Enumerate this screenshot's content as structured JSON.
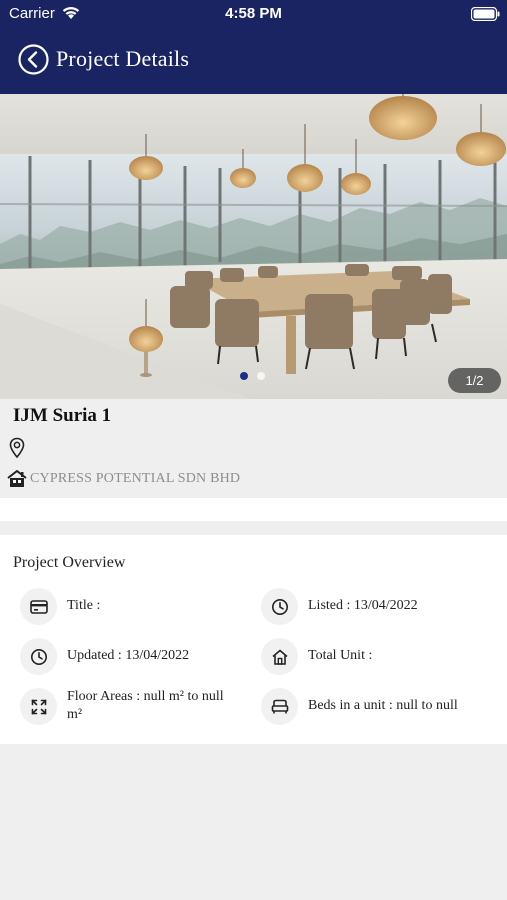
{
  "status_bar": {
    "carrier": "Carrier",
    "time": "4:58 PM"
  },
  "nav": {
    "title": "Project Details",
    "back_icon": "back-arrow-circle-icon"
  },
  "gallery": {
    "counter": "1/2",
    "current_page": 1,
    "total_pages": 2
  },
  "project": {
    "name": "IJM Suria 1",
    "developer": "CYPRESS POTENTIAL SDN BHD"
  },
  "overview": {
    "title": "Project Overview",
    "items": [
      {
        "icon": "card-icon",
        "text": "Title :"
      },
      {
        "icon": "clock-icon",
        "text": "Listed : 13/04/2022"
      },
      {
        "icon": "clock-icon",
        "text": "Updated : 13/04/2022"
      },
      {
        "icon": "home-icon",
        "text": "Total Unit :"
      },
      {
        "icon": "expand-icon",
        "text": "Floor Areas : null m² to null m²"
      },
      {
        "icon": "bed-icon",
        "text": "Beds in a unit : null to null"
      }
    ]
  },
  "colors": {
    "header": "#1a2462",
    "accent_dot": "#1a2e8a",
    "muted_text": "#8d8d8d"
  }
}
